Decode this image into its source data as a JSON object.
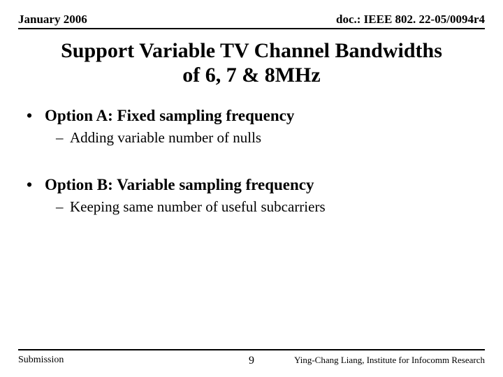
{
  "header": {
    "left": "January 2006",
    "right": "doc.: IEEE 802. 22-05/0094r4"
  },
  "title": {
    "line1": "Support Variable TV Channel Bandwidths",
    "line2": "of 6, 7 & 8MHz"
  },
  "bullets": {
    "optionA": {
      "label": "Option A: Fixed sampling frequency",
      "sub1": "Adding variable number of nulls"
    },
    "optionB": {
      "label": "Option B: Variable sampling frequency",
      "sub1": "Keeping same number of useful subcarriers"
    }
  },
  "footer": {
    "left": "Submission",
    "center": "9",
    "right": "Ying-Chang Liang, Institute for Infocomm Research"
  }
}
